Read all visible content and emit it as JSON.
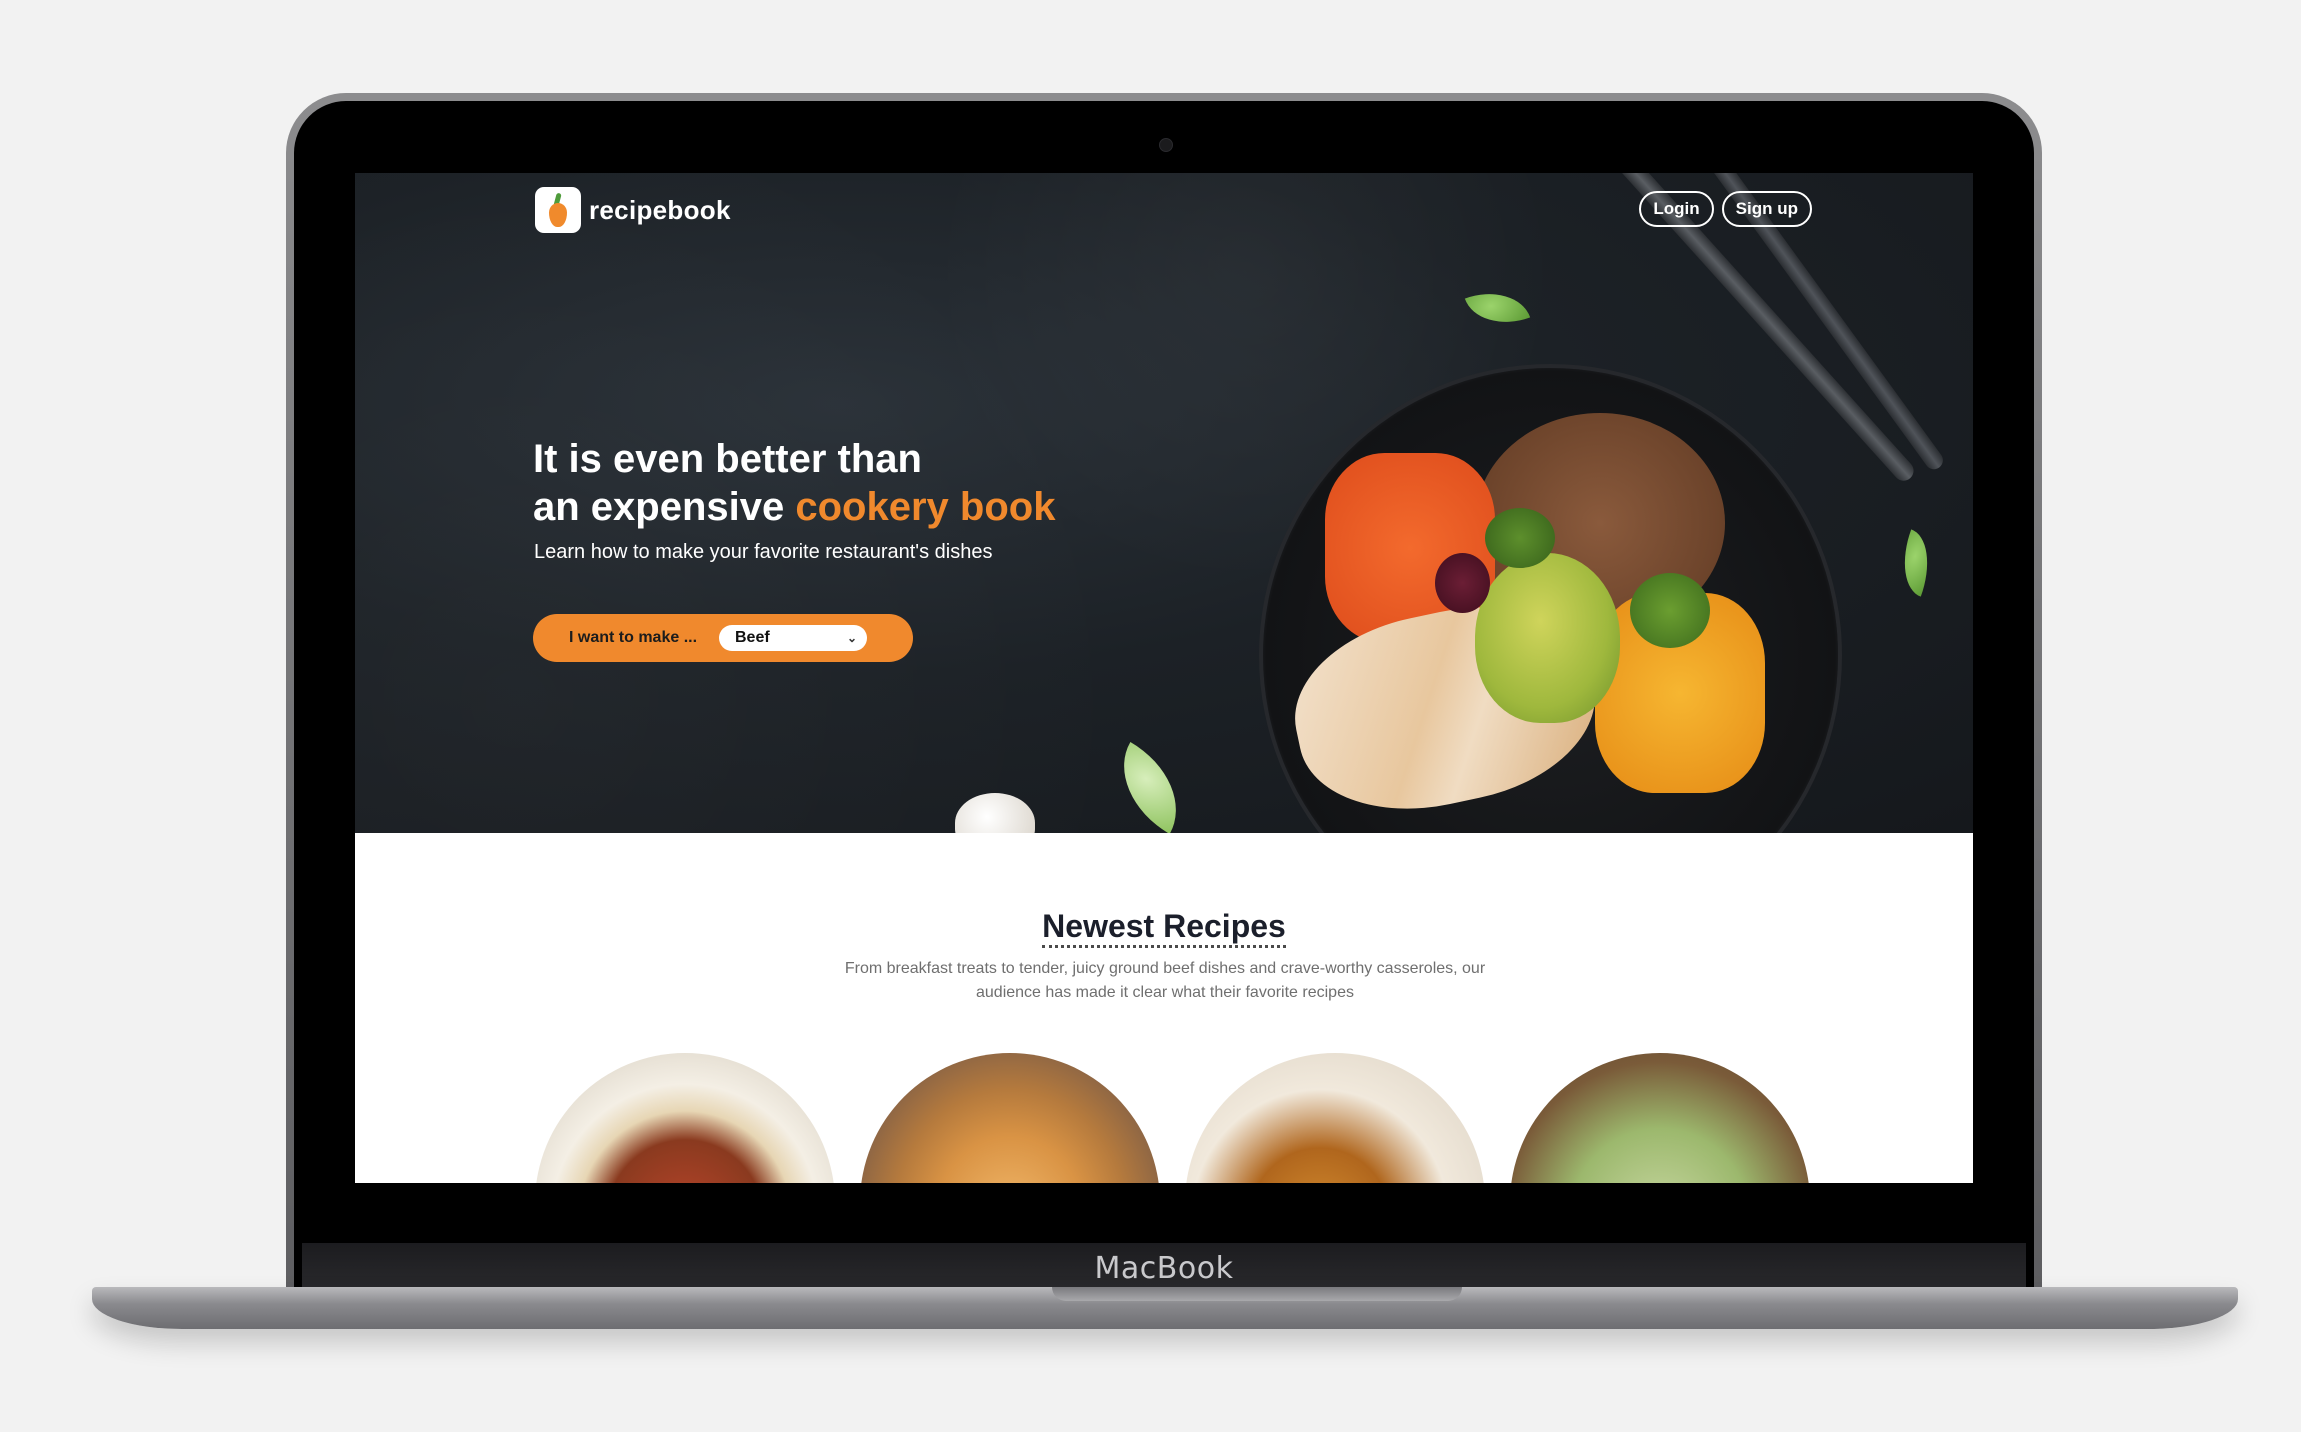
{
  "brand": {
    "name": "recipebook"
  },
  "header": {
    "login_label": "Login",
    "signup_label": "Sign up"
  },
  "hero": {
    "headline_line1": "It is even better than",
    "headline_line2_prefix": "an expensive ",
    "headline_line2_accent": "cookery book",
    "subheading": "Learn how to make your favorite restaurant's dishes",
    "make_label": "I want to make ...",
    "make_selected": "Beef"
  },
  "newest": {
    "title": "Newest Recipes",
    "description": "From breakfast treats to tender, juicy ground beef dishes and crave-worthy casseroles, our audience has made it clear what their favorite recipes"
  },
  "device": {
    "label": "MacBook"
  },
  "colors": {
    "accent": "#f0892d",
    "hero_bg": "#1c2126",
    "text_dark": "#1b1f2b"
  },
  "icons": [
    "carrot-logo-icon",
    "chevron-down-icon"
  ]
}
